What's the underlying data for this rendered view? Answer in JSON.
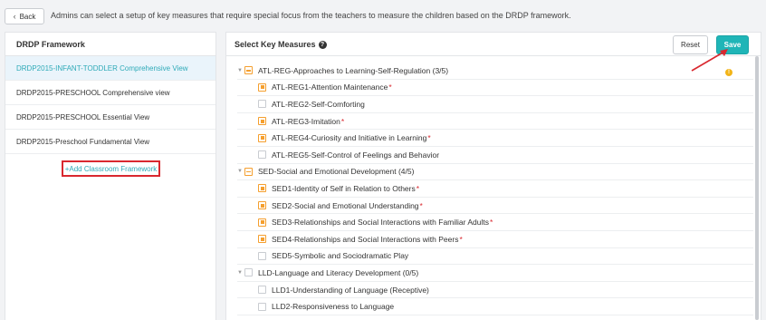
{
  "topbar": {
    "back_label": "Back",
    "description": "Admins can select a setup of key measures that require special focus from the teachers to measure the children based on the DRDP framework."
  },
  "frameworks": {
    "title": "DRDP Framework",
    "items": [
      {
        "label": "DRDP2015-INFANT-TODDLER Comprehensive View",
        "active": true
      },
      {
        "label": "DRDP2015-PRESCHOOL Comprehensive view",
        "active": false
      },
      {
        "label": "DRDP2015-PRESCHOOL Essential View",
        "active": false
      },
      {
        "label": "DRDP2015-Preschool Fundamental View",
        "active": false
      }
    ],
    "add_label": "+Add Classroom Framework"
  },
  "measures": {
    "title": "Select Key Measures",
    "reset_label": "Reset",
    "save_label": "Save",
    "groups": [
      {
        "label": "ATL-REG-Approaches to Learning-Self-Regulation (3/5)",
        "state": "partial",
        "items": [
          {
            "label": "ATL-REG1-Attention Maintenance",
            "checked": true,
            "required": true
          },
          {
            "label": "ATL-REG2-Self-Comforting",
            "checked": false,
            "required": false
          },
          {
            "label": "ATL-REG3-Imitation",
            "checked": true,
            "required": true
          },
          {
            "label": "ATL-REG4-Curiosity and Initiative in Learning",
            "checked": true,
            "required": true
          },
          {
            "label": "ATL-REG5-Self-Control of Feelings and Behavior",
            "checked": false,
            "required": false
          }
        ]
      },
      {
        "label": "SED-Social and Emotional Development (4/5)",
        "state": "partial",
        "items": [
          {
            "label": "SED1-Identity of Self in Relation to Others",
            "checked": true,
            "required": true
          },
          {
            "label": "SED2-Social and Emotional Understanding",
            "checked": true,
            "required": true
          },
          {
            "label": "SED3-Relationships and Social Interactions with Familiar Adults",
            "checked": true,
            "required": true
          },
          {
            "label": "SED4-Relationships and Social Interactions with Peers",
            "checked": true,
            "required": true
          },
          {
            "label": "SED5-Symbolic and Sociodramatic Play",
            "checked": false,
            "required": false
          }
        ]
      },
      {
        "label": "LLD-Language and Literacy Development (0/5)",
        "state": "none",
        "items": [
          {
            "label": "LLD1-Understanding of Language (Receptive)",
            "checked": false,
            "required": false
          },
          {
            "label": "LLD2-Responsiveness to Language",
            "checked": false,
            "required": false
          }
        ]
      }
    ],
    "required_mark": "*"
  },
  "colors": {
    "accent": "#1fb5b7",
    "link": "#2eaab8",
    "checkbox": "#f59f2e",
    "required": "#d9282f",
    "highlight_box": "#d9282f"
  },
  "icons": {
    "back": "chevron-left-icon",
    "help": "question-circle-icon",
    "warning": "exclamation-circle-icon",
    "caret": "caret-down-icon"
  }
}
